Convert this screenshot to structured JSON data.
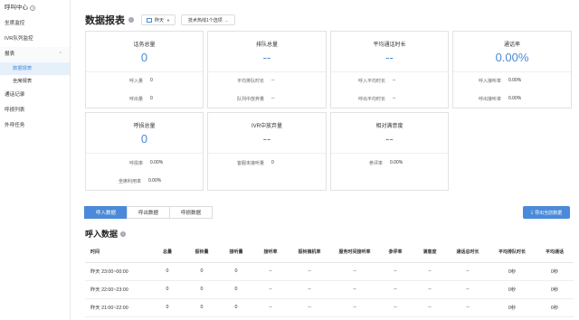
{
  "sidebar": {
    "title": "呼叫中心",
    "items": [
      {
        "label": "坐席监控"
      },
      {
        "label": "IVR队列监控"
      },
      {
        "label": "报表"
      }
    ],
    "report_subitems": [
      {
        "label": "数据报表",
        "active": true
      },
      {
        "label": "坐席报表",
        "active": false
      }
    ],
    "bottom_items": [
      {
        "label": "通话记录"
      },
      {
        "label": "呼损列表"
      },
      {
        "label": "外呼任务"
      }
    ]
  },
  "header": {
    "title": "数据报表",
    "date_select": "昨天",
    "filter_select": "技术热线1个选项"
  },
  "cards": {
    "inbound_total": {
      "title": "话务总量",
      "value": "0",
      "rows": [
        {
          "k": "呼入量",
          "v": "0"
        },
        {
          "k": "呼出量",
          "v": "0"
        }
      ]
    },
    "queue_total": {
      "title": "排队总量",
      "value": "--",
      "rows": [
        {
          "k": "平均排队时长",
          "v": "--"
        },
        {
          "k": "队列中放弃量",
          "v": "--"
        }
      ]
    },
    "avg_talk": {
      "title": "平均通话时长",
      "value": "--",
      "rows": [
        {
          "k": "呼入平均时长",
          "v": "--"
        },
        {
          "k": "呼出平均时长",
          "v": "--"
        }
      ]
    },
    "connect_rate": {
      "title": "通话率",
      "value": "0.00%",
      "rows": [
        {
          "k": "呼入接听率",
          "v": "0.00%"
        },
        {
          "k": "呼出接听率",
          "v": "0.00%"
        }
      ]
    },
    "call_loss": {
      "title": "呼损总量",
      "value": "0",
      "rows": [
        {
          "k": "呼损率",
          "v": "0.00%"
        },
        {
          "k": "坐席利用率",
          "v": "0.00%"
        }
      ]
    },
    "ivr_abandon": {
      "title": "IVR中放弃量",
      "value": "--",
      "rows": [
        {
          "k": "客服未接听量",
          "v": "0"
        }
      ]
    },
    "satisfaction": {
      "title": "相对满意度",
      "value": "--",
      "rows": [
        {
          "k": "参评率",
          "v": "0.00%"
        }
      ]
    }
  },
  "tabs": [
    "呼入数据",
    "呼出数据",
    "呼损数据"
  ],
  "export_label": "导出当前数据",
  "section_title": "呼入数据",
  "table": {
    "columns": [
      "时间",
      "总量",
      "振铃量",
      "接听量",
      "接听率",
      "振铃摘机率",
      "服务时间接听率",
      "参评率",
      "满意度",
      "通话总时长",
      "平均排队时长",
      "平均通话"
    ],
    "rows": [
      [
        "昨天 23:00~00:00",
        "0",
        "0",
        "0",
        "--",
        "--",
        "--",
        "--",
        "--",
        "--",
        "0秒",
        "0秒"
      ],
      [
        "昨天 22:00~23:00",
        "0",
        "0",
        "0",
        "--",
        "--",
        "--",
        "--",
        "--",
        "--",
        "0秒",
        "0秒"
      ],
      [
        "昨天 21:00~22:00",
        "0",
        "0",
        "0",
        "--",
        "--",
        "--",
        "--",
        "--",
        "--",
        "0秒",
        "0秒"
      ]
    ]
  }
}
